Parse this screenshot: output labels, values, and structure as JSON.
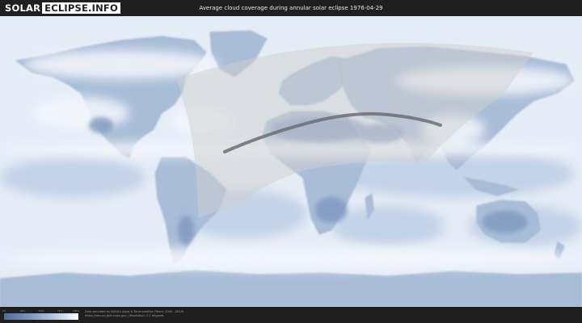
{
  "header": {
    "logo_solar": "SOLAR",
    "logo_domain": "ECLIPSE.INFO",
    "title": "Average cloud coverage during annular solar eclipse 1976-04-29"
  },
  "map": {
    "ocean_color": "#e4ecf6",
    "land_color": "#9fb4d1",
    "cloud_color": "#f2f6fb",
    "eclipse_path_color": "#6b6f75",
    "visibility_zone_color": "#c8c8c8"
  },
  "legend": {
    "ticks": [
      "0%",
      "25%",
      "50%",
      "75%",
      "100%"
    ],
    "colors": [
      "#4f6b9b",
      "#7d97bd",
      "#b9cbe2",
      "#ffffff"
    ]
  },
  "footer": {
    "credit_line1": "Data provided by NASA's Aqua & Terra satellite (Years: 2000 - 2019)",
    "credit_line2": "https://neo.sci.gsfc.nasa.gov | Resolution: 0.1 degrees"
  }
}
